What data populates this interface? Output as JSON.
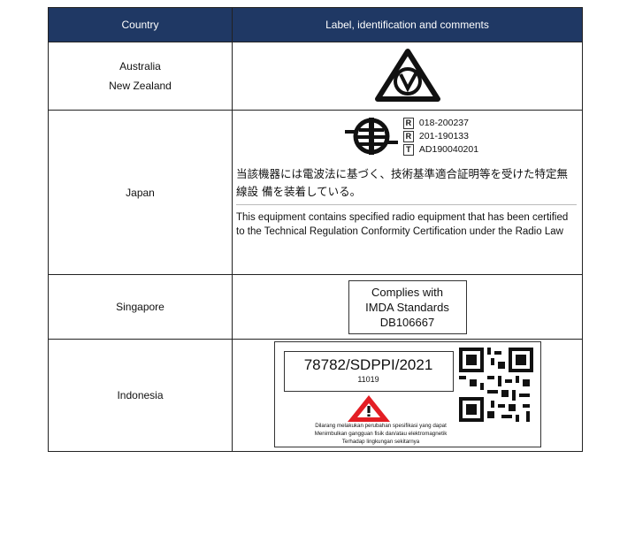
{
  "table": {
    "headers": [
      "Country",
      "Label, identification and comments"
    ],
    "rows": {
      "australia": {
        "countries": [
          "Australia",
          "New Zealand"
        ],
        "mark": "rcm-icon"
      },
      "japan": {
        "country": "Japan",
        "codes": [
          {
            "letter": "R",
            "value": "018-200237"
          },
          {
            "letter": "R",
            "value": "201-190133"
          },
          {
            "letter": "T",
            "value": "AD190040201"
          }
        ],
        "jp_text": "当該機器には電波法に基づく、技術基準適合証明等を受けた特定無線設 備を装着している。",
        "en_text": "This equipment contains specified radio equipment that has been certified to the Technical Regulation Conformity Certification under the Radio Law"
      },
      "singapore": {
        "country": "Singapore",
        "label_lines": [
          "Complies with",
          "IMDA Standards",
          "DB106667"
        ]
      },
      "indonesia": {
        "country": "Indonesia",
        "cert_number": "78782/SDPPI/2021",
        "sub_number": "11019",
        "warning_lines": [
          "Dilarang melakukan perubahan spesifikasi yang dapat",
          "Menimbulkan gangguan fisik dan/atau elektromagnetik",
          "Terhadap lingkungan sekitarnya"
        ]
      }
    }
  }
}
